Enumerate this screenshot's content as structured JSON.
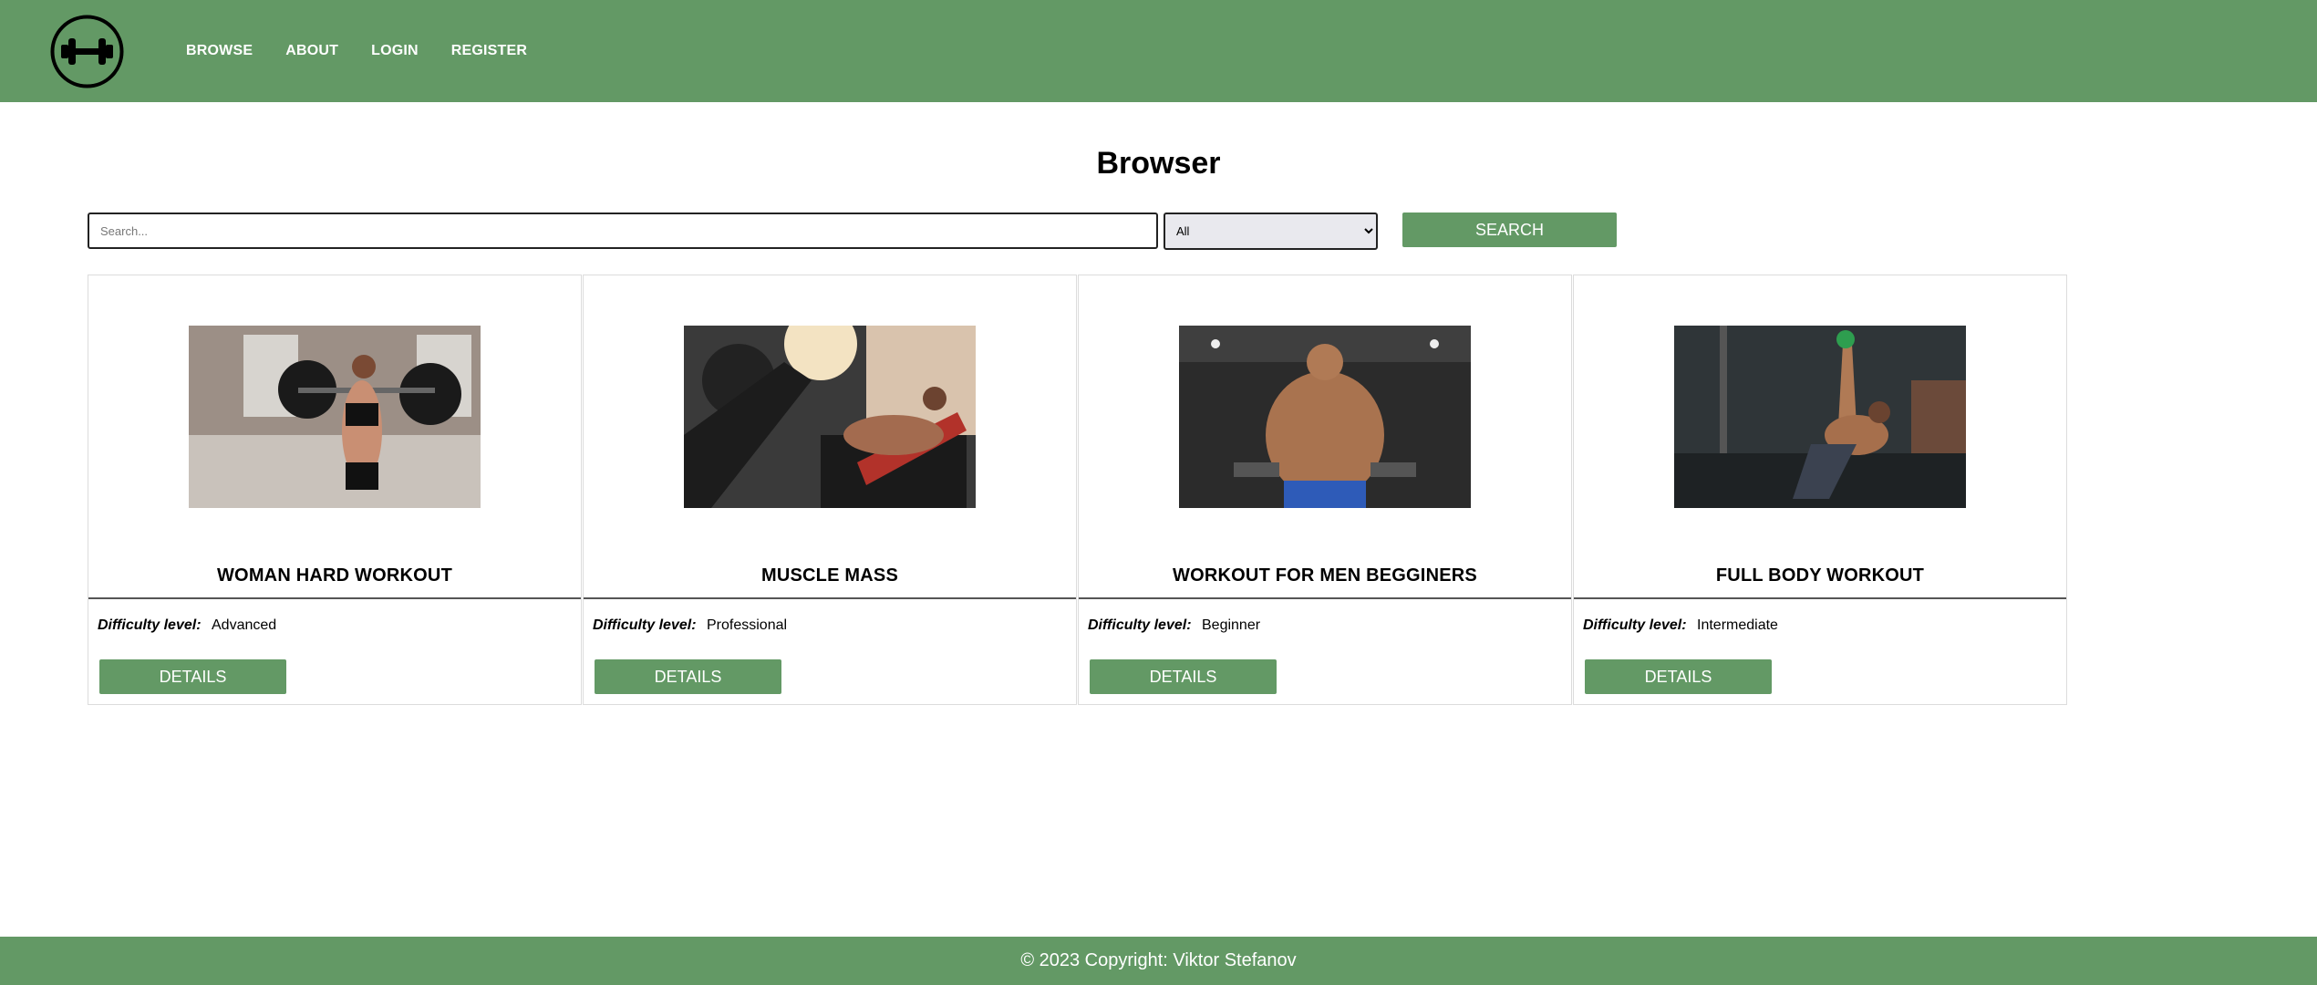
{
  "header": {
    "nav": [
      "BROWSE",
      "ABOUT",
      "LOGIN",
      "REGISTER"
    ],
    "logo_icon": "dumbbell-icon"
  },
  "page": {
    "title": "Browser"
  },
  "search": {
    "placeholder": "Search...",
    "value": "",
    "filter_selected": "All",
    "button_label": "SEARCH"
  },
  "cards": [
    {
      "title": "WOMAN HARD WORKOUT",
      "difficulty_label": "Difficulty level:",
      "difficulty": "Advanced",
      "button_label": "DETAILS"
    },
    {
      "title": "MUSCLE MASS",
      "difficulty_label": "Difficulty level:",
      "difficulty": "Professional",
      "button_label": "DETAILS"
    },
    {
      "title": "WORKOUT FOR MEN BEGGINERS",
      "difficulty_label": "Difficulty level:",
      "difficulty": "Beginner",
      "button_label": "DETAILS"
    },
    {
      "title": "FULL BODY WORKOUT",
      "difficulty_label": "Difficulty level:",
      "difficulty": "Intermediate",
      "button_label": "DETAILS"
    }
  ],
  "footer": {
    "text": "© 2023 Copyright: Viktor Stefanov"
  },
  "colors": {
    "primary": "#639965",
    "text": "#000000",
    "background": "#ffffff"
  }
}
